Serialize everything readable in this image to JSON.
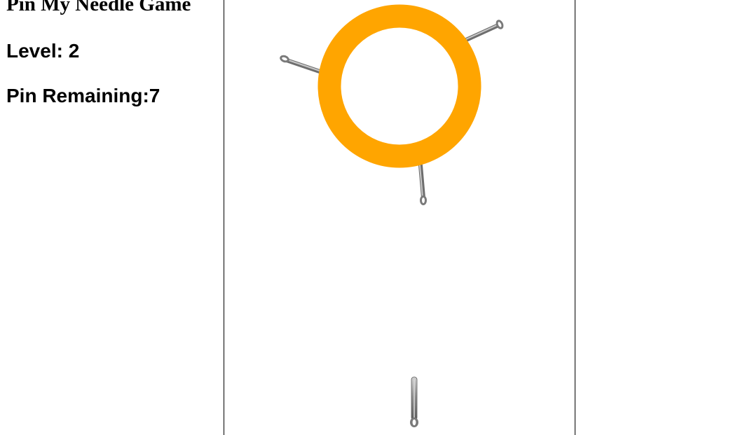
{
  "game": {
    "title": "Pin My Needle Game",
    "level_text": "Level: 2",
    "pins_remaining_text": "Pin Remaining:7",
    "level": 2,
    "pins_remaining": 7,
    "ring_color": "#FFA500",
    "needle_color": "#8a8a8a",
    "stuck_needles": 3,
    "ready_needles": 1
  }
}
